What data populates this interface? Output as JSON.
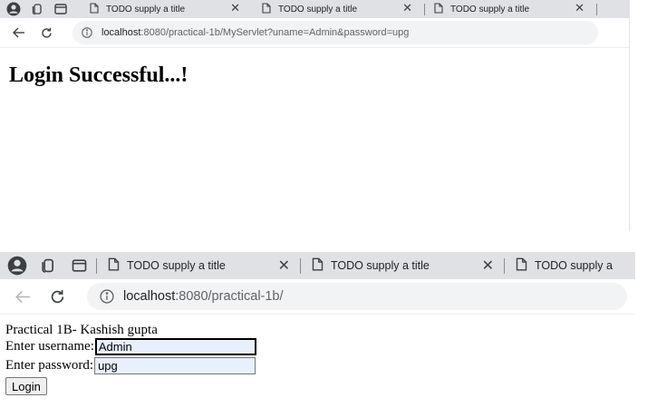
{
  "top_window": {
    "tabs": [
      {
        "title": "TODO supply a title"
      },
      {
        "title": "TODO supply a title"
      },
      {
        "title": "TODO supply a title"
      }
    ],
    "address": {
      "host": "localhost",
      "rest": ":8080/practical-1b/MyServlet?uname=Admin&password=upg"
    },
    "page": {
      "heading": "Login Successful...!"
    }
  },
  "bottom_window": {
    "tabs": [
      {
        "title": "TODO supply a title"
      },
      {
        "title": "TODO supply a title"
      },
      {
        "title": "TODO supply a"
      }
    ],
    "address": {
      "host": "localhost",
      "rest": ":8080/practical-1b/"
    },
    "page": {
      "heading": "Practical 1B- Kashish gupta",
      "username_label": "Enter username:",
      "username_value": "Admin",
      "password_label": "Enter password:",
      "password_value": "upg",
      "login_label": "Login"
    }
  },
  "icons": {
    "profile": "profile-icon",
    "workspaces": "workspaces-icon",
    "tab_actions": "tab-actions-icon",
    "document": "document-icon",
    "close": "close-icon",
    "back": "back-arrow-icon",
    "reload": "reload-icon",
    "info": "info-icon"
  },
  "colors": {
    "tab_strip": "#dfe1e5",
    "omnibox": "#f1f3f4",
    "autofill_bg": "#e8f0fe"
  }
}
